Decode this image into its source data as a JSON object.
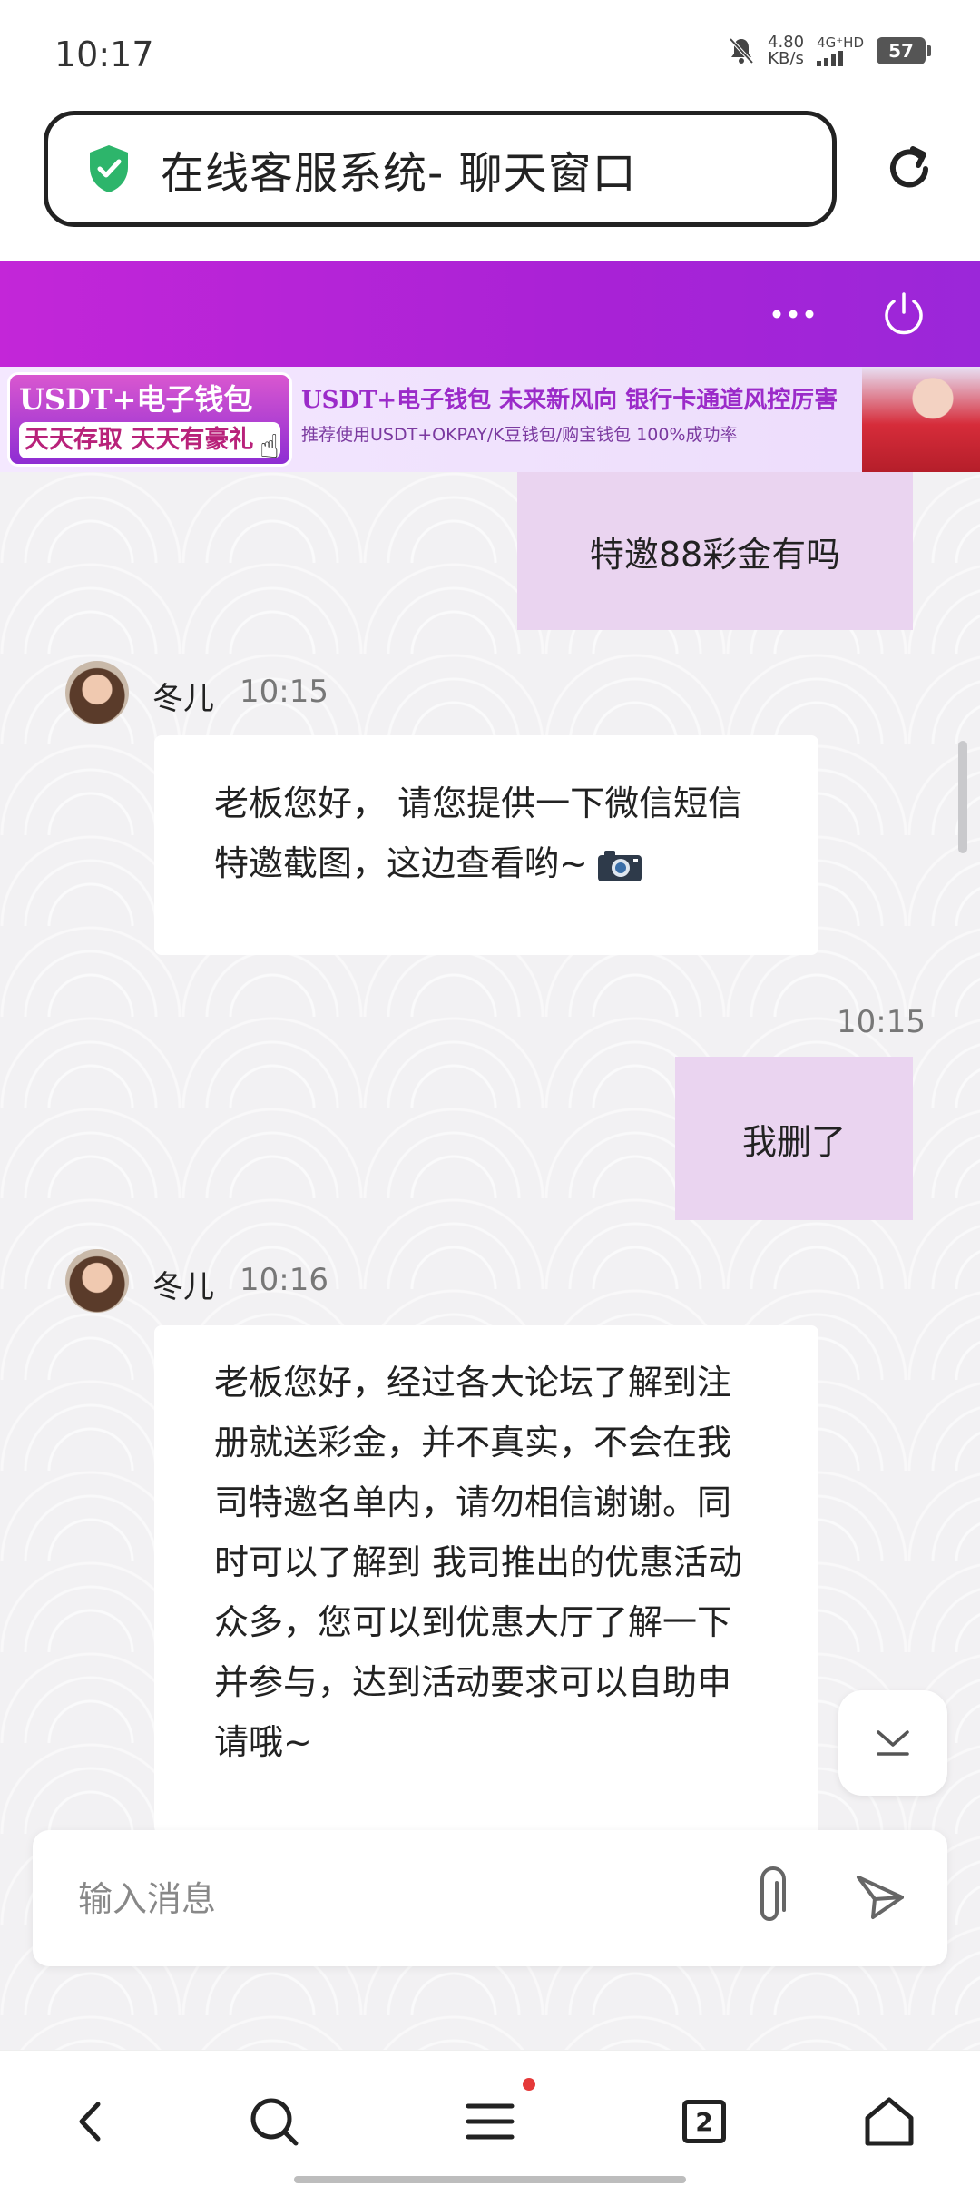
{
  "status_bar": {
    "time": "10:17",
    "net_speed_value": "4.80",
    "net_speed_unit": "KB/s",
    "net_type": "4G⁺HD",
    "battery": "57",
    "icons": [
      "mute-bell-icon",
      "signal-icon",
      "battery-icon"
    ]
  },
  "browser": {
    "url_title": "在线客服系统- 聊天窗口",
    "secure_icon": "shield-check-icon",
    "refresh_icon": "refresh-icon"
  },
  "header": {
    "accent_color": "#b022d6",
    "icons": [
      "more-icon",
      "power-icon"
    ]
  },
  "banner": {
    "left_title": "USDT+电子钱包",
    "left_slogan": "天天存取 天天有豪礼",
    "headline": "USDT+电子钱包  未来新风向  银行卡通道风控厉害",
    "subline": "推荐使用USDT+OKPAY/K豆钱包/购宝钱包   100%成功率"
  },
  "messages": [
    {
      "direction": "out",
      "text": "特邀88彩金有吗"
    },
    {
      "direction": "in",
      "sender": "冬儿",
      "time": "10:15",
      "text": "老板您好， 请您提供一下微信短信特邀截图，这边查看哟~",
      "icon": "camera-icon"
    },
    {
      "direction": "out",
      "time": "10:15",
      "text": "我删了"
    },
    {
      "direction": "in",
      "sender": "冬儿",
      "time": "10:16",
      "text": "老板您好，经过各大论坛了解到注册就送彩金，并不真实，不会在我司特邀名单内，请勿相信谢谢。同时可以了解到 我司推出的优惠活动众多，您可以到优惠大厅了解一下并参与，达到活动要求可以自助申请哦~"
    }
  ],
  "composer": {
    "placeholder": "输入消息",
    "icons": [
      "paperclip-icon",
      "send-icon"
    ]
  },
  "bottom_nav": {
    "tab_count": "2",
    "icons": [
      "back-icon",
      "search-icon",
      "menu-icon",
      "tabs-icon",
      "home-icon"
    ]
  }
}
